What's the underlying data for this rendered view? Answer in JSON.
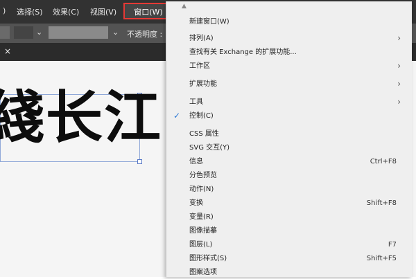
{
  "menubar": {
    "items": [
      ")",
      "选择(S)",
      "效果(C)",
      "视图(V)",
      "窗口(W)"
    ]
  },
  "options_bar": {
    "opacity_label": "不透明度 :"
  },
  "tab": {
    "close_glyph": "×"
  },
  "canvas": {
    "text": "綫长江"
  },
  "dropdown": {
    "items": [
      {
        "label": "新建窗口(W)"
      },
      {
        "label": "排列(A)",
        "submenu": true
      },
      {
        "label": "查找有关 Exchange 的扩展功能..."
      },
      {
        "label": "工作区",
        "submenu": true
      },
      {
        "label": "扩展功能",
        "submenu": true
      },
      {
        "label": "工具",
        "submenu": true
      },
      {
        "label": "控制(C)",
        "checked": true
      },
      {
        "label": "CSS 属性"
      },
      {
        "label": "SVG 交互(Y)"
      },
      {
        "label": "信息",
        "shortcut": "Ctrl+F8"
      },
      {
        "label": "分色预览"
      },
      {
        "label": "动作(N)"
      },
      {
        "label": "变换",
        "shortcut": "Shift+F8"
      },
      {
        "label": "变量(R)"
      },
      {
        "label": "图像描摹"
      },
      {
        "label": "图层(L)",
        "shortcut": "F7"
      },
      {
        "label": "图形样式(S)",
        "shortcut": "Shift+F5"
      },
      {
        "label": "图案选项"
      }
    ]
  },
  "colors": {
    "highlight": "#e53935",
    "check": "#2b79d6"
  }
}
